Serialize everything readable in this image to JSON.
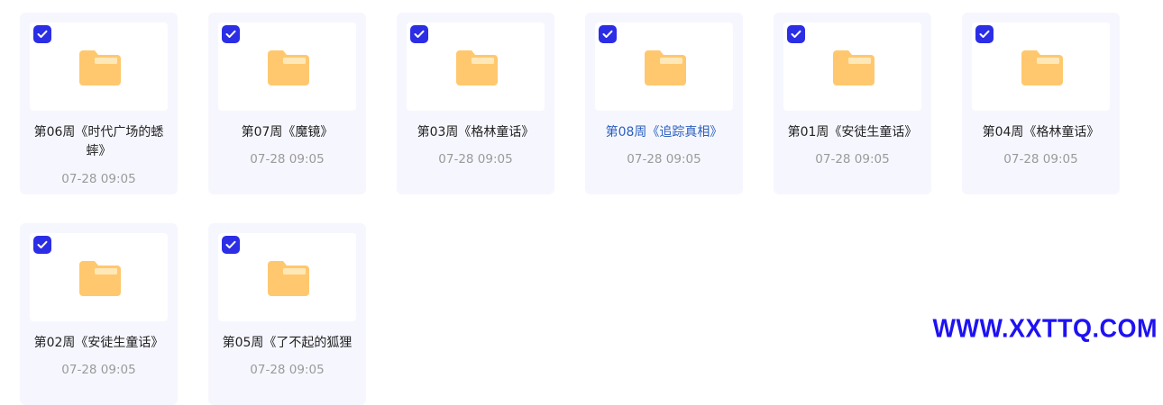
{
  "files": [
    {
      "name": "第06周《时代广场的蟋蟀》",
      "time": "07-28 09:05",
      "checked": true,
      "highlighted": false,
      "lines": 2
    },
    {
      "name": "第07周《魔镜》",
      "time": "07-28 09:05",
      "checked": true,
      "highlighted": false,
      "lines": 1
    },
    {
      "name": "第03周《格林童话》",
      "time": "07-28 09:05",
      "checked": true,
      "highlighted": false,
      "lines": 1
    },
    {
      "name": "第08周《追踪真相》",
      "time": "07-28 09:05",
      "checked": true,
      "highlighted": true,
      "lines": 1
    },
    {
      "name": "第01周《安徒生童话》",
      "time": "07-28 09:05",
      "checked": true,
      "highlighted": false,
      "lines": 1
    },
    {
      "name": "第04周《格林童话》",
      "time": "07-28 09:05",
      "checked": true,
      "highlighted": false,
      "lines": 1
    },
    {
      "name": "第02周《安徒生童话》",
      "time": "07-28 09:05",
      "checked": true,
      "highlighted": false,
      "lines": 1
    },
    {
      "name": "第05周《了不起的狐狸",
      "time": "07-28 09:05",
      "checked": true,
      "highlighted": false,
      "lines": 1
    }
  ],
  "icons": {
    "folder": "folder-icon",
    "check": "checkmark-icon"
  },
  "colors": {
    "card_bg": "#f6f7fe",
    "checkbox": "#2b2ee5",
    "folder_body": "#ffc86e",
    "folder_tab": "#ffe3ab",
    "link": "#2b5fbf",
    "watermark": "#1e12f2"
  },
  "watermark": "WWW.XXTTQ.COM"
}
